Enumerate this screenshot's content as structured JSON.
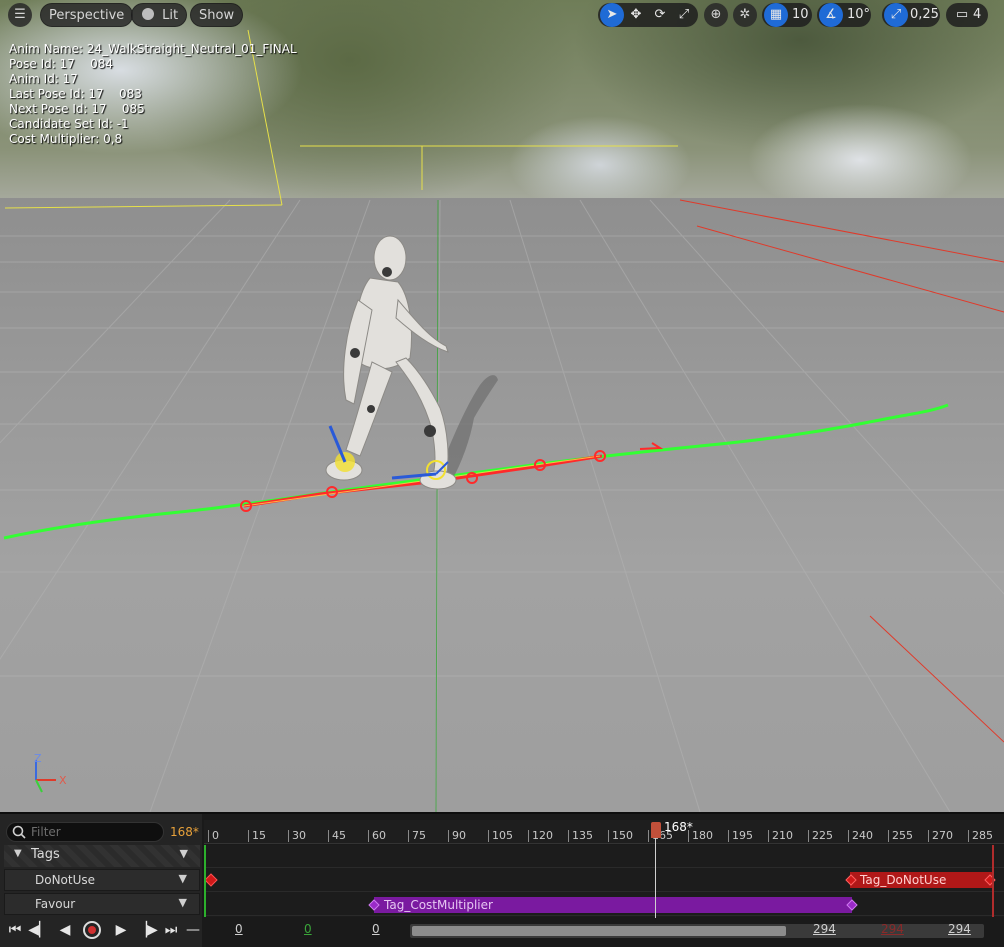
{
  "toolbar": {
    "menu_icon": "hamburger-icon",
    "view_mode": "Perspective",
    "lighting": "Lit",
    "show": "Show",
    "grid_snap": "10",
    "rotation_snap": "10°",
    "scale_snap": "0,25",
    "camera_speed": "4"
  },
  "overlay": {
    "lines": [
      "Anim Name: 24_WalkStraight_Neutral_01_FINAL",
      "Pose Id: 17    084",
      "Anim Id: 17",
      "Last Pose Id: 17    083",
      "Next Pose Id: 17    085",
      "Candidate Set Id: -1",
      "Cost Multiplier: 0,8"
    ]
  },
  "axis": {
    "z": "Z",
    "x": "X"
  },
  "timeline": {
    "filter_placeholder": "Filter",
    "current_frame": "168*",
    "tags_label": "Tags",
    "tracks": [
      "DoNotUse",
      "Favour"
    ],
    "ruler_ticks": [
      "0",
      "15",
      "30",
      "45",
      "60",
      "75",
      "90",
      "105",
      "120",
      "135",
      "150",
      "165",
      "180",
      "195",
      "210",
      "225",
      "240",
      "255",
      "270",
      "285"
    ],
    "playhead_label": "168*",
    "notifies": [
      {
        "label": "Tag_DoNotUse",
        "color": "#b01818"
      },
      {
        "label": "Tag_CostMultiplier",
        "color": "#7a1aa0"
      }
    ],
    "range_start": "0",
    "range_start_green": "0",
    "view_start": "0",
    "view_end": "294",
    "range_end_red": "294",
    "range_end": "294"
  },
  "colors": {
    "accent": "#1f6bd6",
    "trajectory": "#33ff33",
    "playhead": "#c2503a",
    "frame_orange": "#e8a13a"
  }
}
